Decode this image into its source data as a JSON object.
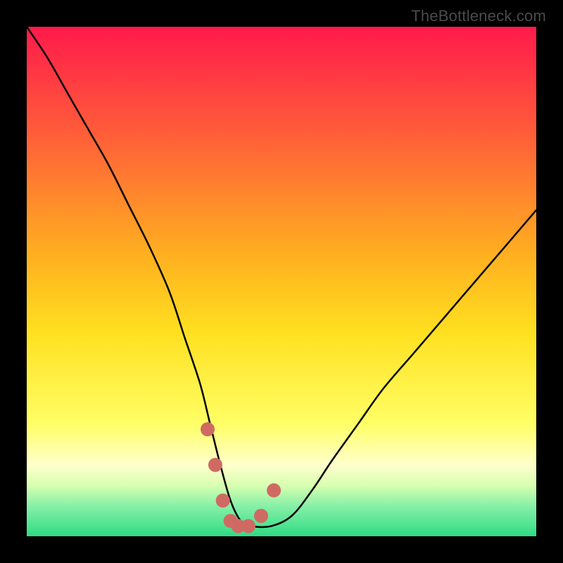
{
  "watermark": {
    "text": "TheBottleneck.com"
  },
  "colors": {
    "frame": "#000000",
    "curve": "#000000",
    "marker": "#cf6a63",
    "watermark": "#4a4a4a"
  },
  "gradient": {
    "stops": [
      {
        "pct": 0,
        "color": "#ff1a4b"
      },
      {
        "pct": 20,
        "color": "#ff5a3a"
      },
      {
        "pct": 45,
        "color": "#ffb020"
      },
      {
        "pct": 60,
        "color": "#ffe020"
      },
      {
        "pct": 78,
        "color": "#ffff66"
      },
      {
        "pct": 86,
        "color": "#ffffcc"
      },
      {
        "pct": 90,
        "color": "#d8ffb0"
      },
      {
        "pct": 94,
        "color": "#88f0a8"
      },
      {
        "pct": 100,
        "color": "#2fdc84"
      }
    ]
  },
  "chart_data": {
    "type": "line",
    "title": "",
    "xlabel": "",
    "ylabel": "",
    "xlim": [
      0,
      100
    ],
    "ylim": [
      0,
      100
    ],
    "grid": false,
    "legend": false,
    "annotations": [],
    "series": [
      {
        "name": "bottleneck-curve",
        "x": [
          0,
          4,
          8,
          12,
          16,
          20,
          24,
          28,
          31,
          34,
          36,
          38,
          40,
          42,
          44,
          48,
          52,
          56,
          60,
          65,
          70,
          76,
          82,
          88,
          94,
          100
        ],
        "y": [
          100,
          94,
          87,
          80,
          73,
          65,
          57,
          48,
          39,
          30,
          22,
          14,
          7,
          3,
          2,
          2,
          4,
          9,
          15,
          22,
          29,
          36,
          43,
          50,
          57,
          64
        ]
      }
    ],
    "markers": {
      "name": "valley-markers",
      "x": [
        35.5,
        37.0,
        38.5,
        40.0,
        41.5,
        43.5,
        46.0,
        48.5
      ],
      "y": [
        21.0,
        14.0,
        7.0,
        3.0,
        2.0,
        2.0,
        4.0,
        9.0
      ],
      "radius_px": 10
    }
  }
}
